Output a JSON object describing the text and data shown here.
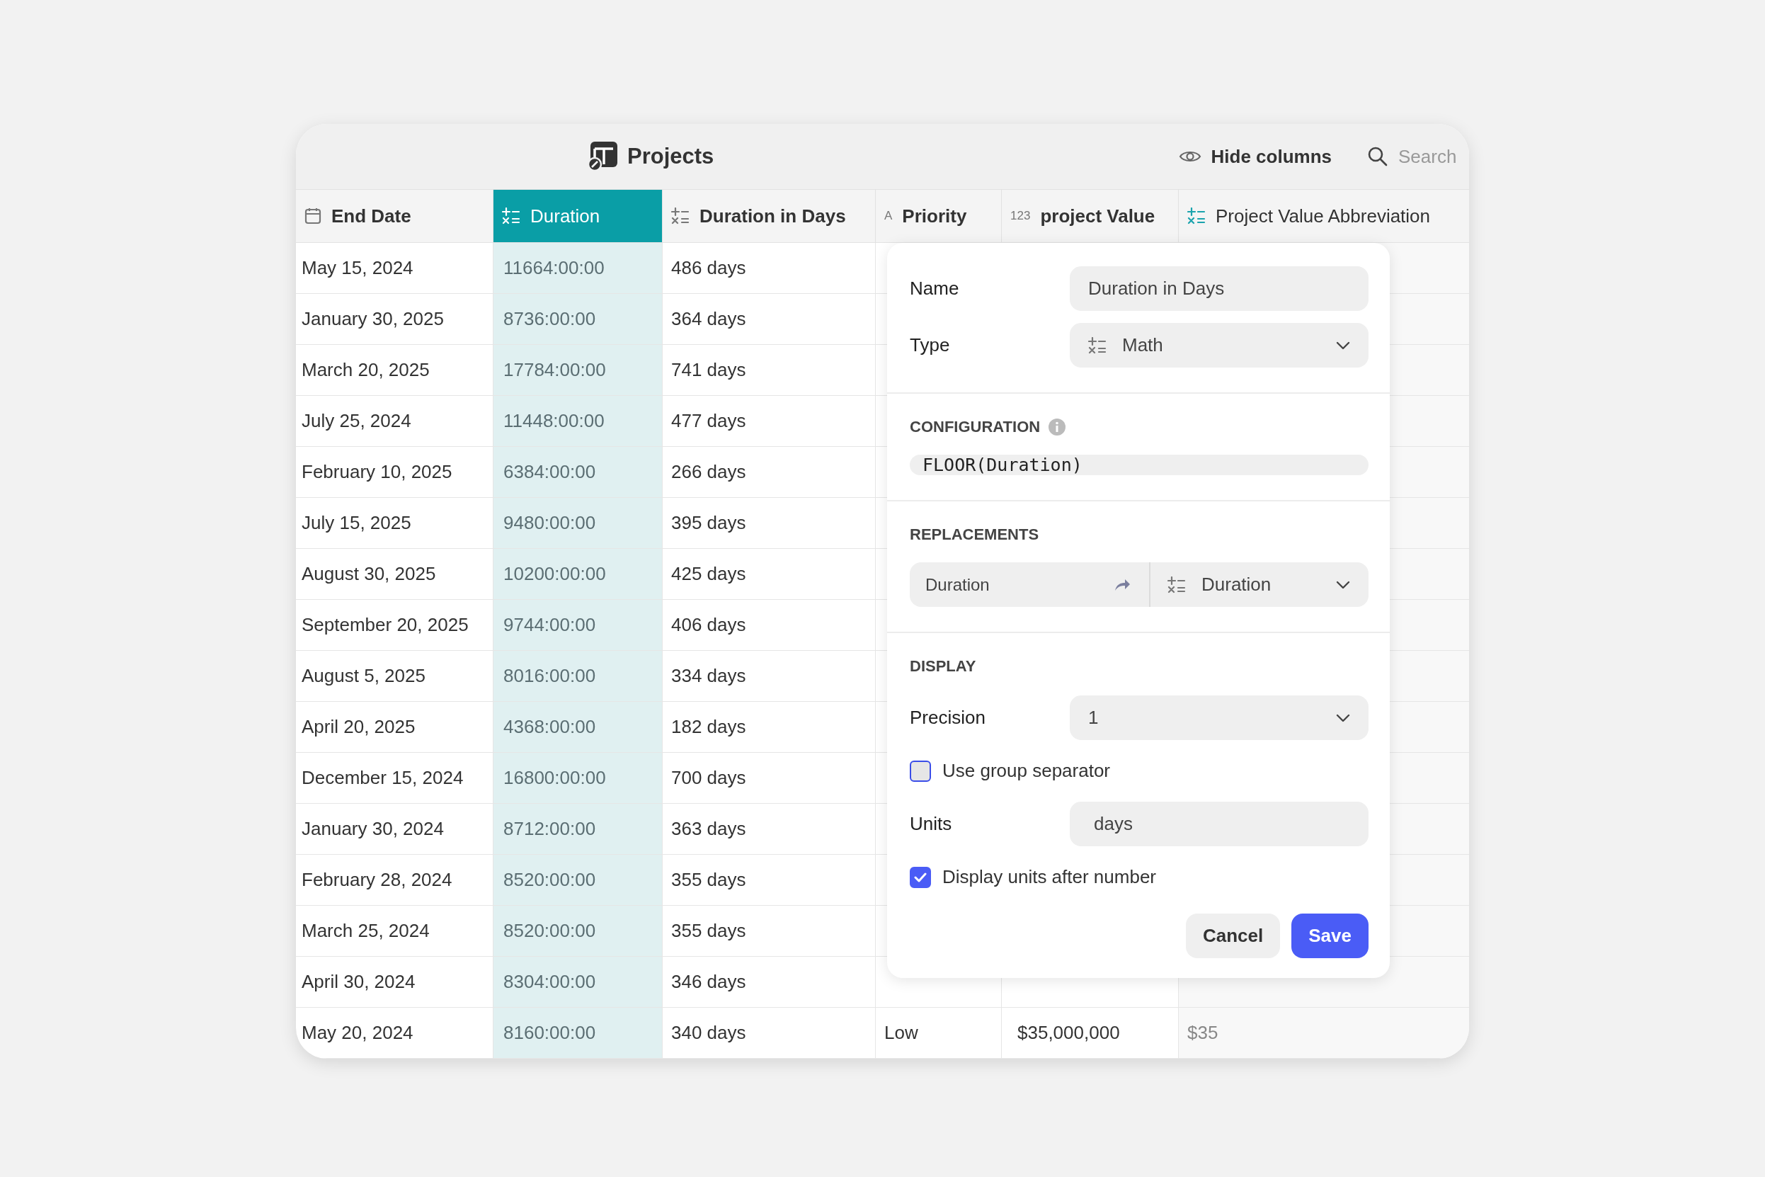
{
  "title": "Projects",
  "toolbar": {
    "hide_columns": "Hide columns",
    "search": {
      "placeholder": "Search"
    }
  },
  "table": {
    "columns": [
      {
        "label": "End Date",
        "kind": "date",
        "selected": false
      },
      {
        "label": "Duration",
        "kind": "math",
        "selected": true
      },
      {
        "label": "Duration in Days",
        "kind": "math",
        "selected": false
      },
      {
        "label": "Priority",
        "kind": "text",
        "icon_text": "A",
        "selected": false
      },
      {
        "label": "project Value",
        "kind": "number",
        "icon_text": "123",
        "selected": false
      },
      {
        "label": "Project Value Abbreviation",
        "kind": "formula",
        "selected": false
      }
    ],
    "rows": [
      [
        "May 15, 2024",
        "11664:00:00",
        "486 days"
      ],
      [
        "January 30, 2025",
        "8736:00:00",
        "364 days"
      ],
      [
        "March 20, 2025",
        "17784:00:00",
        "741 days"
      ],
      [
        "July 25, 2024",
        "11448:00:00",
        "477 days"
      ],
      [
        "February 10, 2025",
        "6384:00:00",
        "266 days"
      ],
      [
        "July 15, 2025",
        "9480:00:00",
        "395 days"
      ],
      [
        "August 30, 2025",
        "10200:00:00",
        "425 days"
      ],
      [
        "September 20, 2025",
        "9744:00:00",
        "406 days"
      ],
      [
        "August 5, 2025",
        "8016:00:00",
        "334 days"
      ],
      [
        "April 20, 2025",
        "4368:00:00",
        "182 days"
      ],
      [
        "December 15, 2024",
        "16800:00:00",
        "700 days"
      ],
      [
        "January 30, 2024",
        "8712:00:00",
        "363 days"
      ],
      [
        "February 28, 2024",
        "8520:00:00",
        "355 days"
      ],
      [
        "March 25, 2024",
        "8520:00:00",
        "355 days"
      ],
      [
        "April 30, 2024",
        "8304:00:00",
        "346 days"
      ],
      [
        "May 20, 2024",
        "8160:00:00",
        "340 days",
        "Low",
        "$35,000,000",
        "$35"
      ]
    ]
  },
  "field_editor": {
    "name_label": "Name",
    "name_value": "Duration in Days",
    "type_label": "Type",
    "type_value": "Math",
    "configuration_heading": "CONFIGURATION",
    "formula": "FLOOR(Duration)",
    "replacements_heading": "REPLACEMENTS",
    "replacements": [
      {
        "from": "Duration",
        "to": "Duration"
      }
    ],
    "display_heading": "DISPLAY",
    "precision_label": "Precision",
    "precision_value": "1",
    "group_separator": {
      "label": "Use group separator",
      "checked": false
    },
    "units_label": "Units",
    "units_value": "days",
    "units_after": {
      "label": "Display units after number",
      "checked": true
    },
    "buttons": [
      {
        "label": "Cancel",
        "kind": "secondary"
      },
      {
        "label": "Save",
        "kind": "primary"
      }
    ]
  }
}
